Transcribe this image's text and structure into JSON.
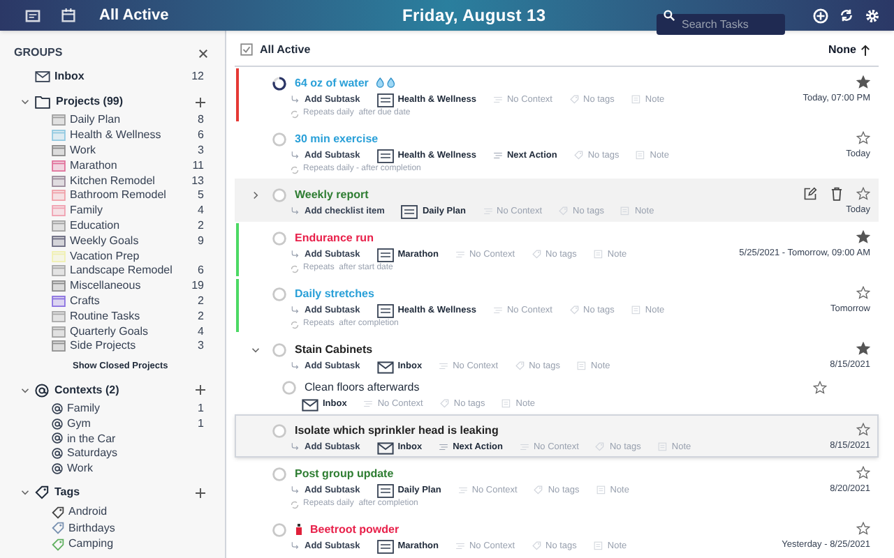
{
  "header": {
    "view_title": "All Active",
    "date": "Friday, August 13",
    "search": {
      "placeholder": "Search Tasks"
    }
  },
  "sidebar": {
    "title": "GROUPS",
    "inbox": {
      "label": "Inbox",
      "count": "12"
    },
    "projects": {
      "label": "Projects (99)",
      "expanded": true,
      "items": [
        {
          "label": "Daily Plan",
          "count": "8",
          "color": "#9e9e9e"
        },
        {
          "label": "Health & Wellness",
          "count": "6",
          "color": "#90c8e0"
        },
        {
          "label": "Work",
          "count": "3",
          "color": "#8a8a8a"
        },
        {
          "label": "Marathon",
          "count": "11",
          "color": "#e0709a"
        },
        {
          "label": "Kitchen Remodel",
          "count": "13",
          "color": "#9a8a9a"
        },
        {
          "label": "Bathroom Remodel",
          "count": "5",
          "color": "#f0a0a8"
        },
        {
          "label": "Family",
          "count": "4",
          "color": "#f0a0b0"
        },
        {
          "label": "Education",
          "count": "2",
          "color": "#a0a0a0"
        },
        {
          "label": "Weekly Goals",
          "count": "9",
          "color": "#6a6a80"
        },
        {
          "label": "Vacation Prep",
          "color": "#f0f0b0"
        },
        {
          "label": "Landscape Remodel",
          "count": "6",
          "color": "#a8a8a8"
        },
        {
          "label": "Miscellaneous",
          "count": "19",
          "color": "#8a8a8a"
        },
        {
          "label": "Crafts",
          "count": "2",
          "color": "#8a70e0"
        },
        {
          "label": "Routine Tasks",
          "count": "2",
          "color": "#a8a8a8"
        },
        {
          "label": "Quarterly Goals",
          "count": "4",
          "color": "#a0a0a0"
        },
        {
          "label": "Side Projects",
          "count": "3",
          "color": "#909090"
        }
      ],
      "show_closed": "Show Closed Projects"
    },
    "contexts": {
      "label": "Contexts (2)",
      "expanded": true,
      "items": [
        {
          "label": "Family",
          "count": "1"
        },
        {
          "label": "Gym",
          "count": "1"
        },
        {
          "label": "in the Car"
        },
        {
          "label": "Saturdays"
        },
        {
          "label": "Work"
        }
      ]
    },
    "tags": {
      "label": "Tags",
      "expanded": true,
      "items": [
        {
          "label": "Android",
          "color": "#444444"
        },
        {
          "label": "Birthdays",
          "color": "#7890b0"
        },
        {
          "label": "Camping",
          "color": "#60b060"
        }
      ]
    }
  },
  "list": {
    "title": "All Active",
    "sort": "None",
    "tasks": [
      {
        "title": "64 oz of water",
        "color": "#2aa0d8",
        "flag": {
          "color": "#e53935"
        },
        "progress_ring": true,
        "droplets": true,
        "selected": false,
        "hovered": false,
        "starred": true,
        "due": "Today, 07:00 PM",
        "repeat": "Repeats daily  after due date",
        "chips": [
          {
            "kind": "add",
            "text": "Add Subtask"
          },
          {
            "kind": "project",
            "text": "Health & Wellness"
          },
          {
            "kind": "no_context",
            "text": "No Context"
          },
          {
            "kind": "tags",
            "text": "No tags"
          },
          {
            "kind": "note",
            "text": "Note"
          }
        ]
      },
      {
        "title": "30 min exercise",
        "color": "#2aa0d8",
        "selected": false,
        "hovered": false,
        "starred": false,
        "due": "Today",
        "repeat": "Repeats daily - after completion",
        "chips": [
          {
            "kind": "add",
            "text": "Add Subtask"
          },
          {
            "kind": "project",
            "text": "Health & Wellness"
          },
          {
            "kind": "context",
            "text": "Next Action"
          },
          {
            "kind": "tags",
            "text": "No tags"
          },
          {
            "kind": "note",
            "text": "Note"
          }
        ]
      },
      {
        "title": "Weekly report",
        "color": "#2e7d32",
        "expanded": false,
        "selected": false,
        "hovered": true,
        "starred": false,
        "due": "Today",
        "chips": [
          {
            "kind": "add",
            "text": "Add checklist item"
          },
          {
            "kind": "project",
            "text": "Daily Plan"
          },
          {
            "kind": "no_context",
            "text": "No Context"
          },
          {
            "kind": "tags",
            "text": "No tags"
          },
          {
            "kind": "note",
            "text": "Note"
          }
        ]
      },
      {
        "title": "Endurance run",
        "color": "#e8204a",
        "flag": {
          "color": "#4cd964"
        },
        "selected": false,
        "hovered": false,
        "starred": true,
        "due": "5/25/2021 - Tomorrow, 09:00 AM",
        "repeat": "Repeats  after start date",
        "chips": [
          {
            "kind": "add",
            "text": "Add Subtask"
          },
          {
            "kind": "project",
            "text": "Marathon"
          },
          {
            "kind": "no_context",
            "text": "No Context"
          },
          {
            "kind": "tags",
            "text": "No tags"
          },
          {
            "kind": "note",
            "text": "Note"
          }
        ]
      },
      {
        "title": "Daily stretches",
        "color": "#2aa0d8",
        "flag": {
          "color": "#4cd964"
        },
        "selected": false,
        "hovered": false,
        "starred": false,
        "due": "Tomorrow",
        "repeat": "Repeats  after completion",
        "chips": [
          {
            "kind": "add",
            "text": "Add Subtask"
          },
          {
            "kind": "project",
            "text": "Health & Wellness"
          },
          {
            "kind": "no_context",
            "text": "No Context"
          },
          {
            "kind": "tags",
            "text": "No tags"
          },
          {
            "kind": "note",
            "text": "Note"
          }
        ]
      },
      {
        "title": "Stain Cabinets",
        "color": "#222222",
        "expanded": true,
        "selected": false,
        "hovered": false,
        "starred": true,
        "due": "8/15/2021",
        "chips": [
          {
            "kind": "add",
            "text": "Add Subtask"
          },
          {
            "kind": "inbox",
            "text": "Inbox"
          },
          {
            "kind": "no_context",
            "text": "No Context"
          },
          {
            "kind": "tags",
            "text": "No tags"
          },
          {
            "kind": "note",
            "text": "Note"
          }
        ],
        "children": [
          {
            "title": "Clean floors afterwards",
            "starred": false,
            "chips": [
              {
                "kind": "inbox",
                "text": "Inbox"
              },
              {
                "kind": "no_context",
                "text": "No Context"
              },
              {
                "kind": "tags",
                "text": "No tags"
              },
              {
                "kind": "note",
                "text": "Note"
              }
            ]
          }
        ]
      },
      {
        "title": "Isolate which sprinkler head is leaking",
        "color": "#222222",
        "selected": true,
        "hovered": false,
        "starred": false,
        "due": "8/15/2021",
        "chips": [
          {
            "kind": "add",
            "text": "Add Subtask"
          },
          {
            "kind": "inbox",
            "text": "Inbox"
          },
          {
            "kind": "context",
            "text": "Next Action"
          },
          {
            "kind": "no_context",
            "text": "No Context"
          },
          {
            "kind": "tags",
            "text": "No tags"
          },
          {
            "kind": "note",
            "text": "Note"
          }
        ]
      },
      {
        "title": "Post group update",
        "color": "#2e7d32",
        "selected": false,
        "hovered": false,
        "starred": false,
        "due": "8/20/2021",
        "repeat": "Repeats daily  after completion",
        "chips": [
          {
            "kind": "add",
            "text": "Add Subtask"
          },
          {
            "kind": "project",
            "text": "Daily Plan"
          },
          {
            "kind": "no_context",
            "text": "No Context"
          },
          {
            "kind": "tags",
            "text": "No tags"
          },
          {
            "kind": "note",
            "text": "Note"
          }
        ]
      },
      {
        "title": "Beetroot powder",
        "color": "#e8204a",
        "flask": true,
        "selected": false,
        "hovered": false,
        "starred": false,
        "due": "Yesterday - 8/25/2021",
        "chips": [
          {
            "kind": "add",
            "text": "Add Subtask"
          },
          {
            "kind": "project",
            "text": "Marathon"
          },
          {
            "kind": "no_context",
            "text": "No Context"
          },
          {
            "kind": "tags",
            "text": "No tags"
          },
          {
            "kind": "note",
            "text": "Note"
          }
        ]
      }
    ]
  }
}
